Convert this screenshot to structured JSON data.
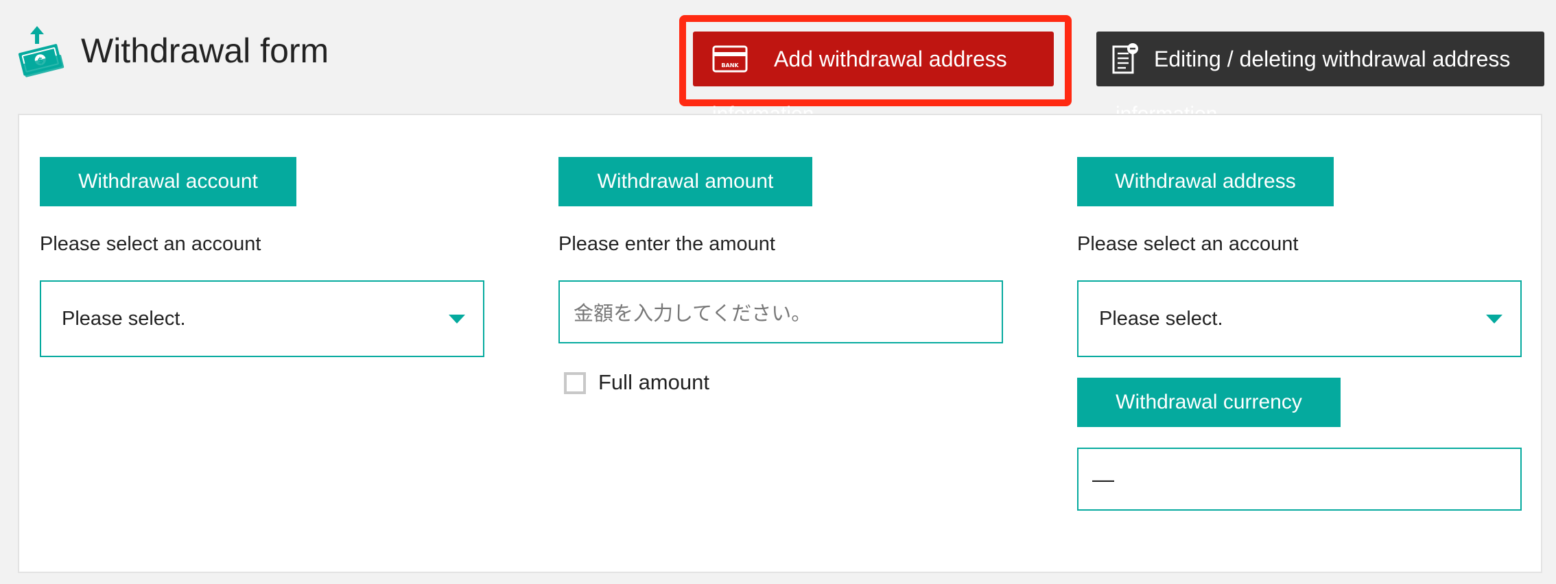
{
  "header": {
    "title": "Withdrawal form",
    "page_icon": "money-withdraw-icon"
  },
  "actions": {
    "add_address": {
      "label": "Add withdrawal address",
      "caption": "information",
      "icon": "bank-card-icon",
      "color": "#bf1511"
    },
    "edit_address": {
      "label": "Editing / deleting withdrawal address",
      "caption": "information",
      "icon": "document-remove-icon",
      "color": "#333333"
    },
    "highlight_color": "#ff2a12"
  },
  "form": {
    "accent_color": "#05aa9e",
    "account": {
      "heading": "Withdrawal account",
      "instruction": "Please select an account",
      "selected": "Please select."
    },
    "amount": {
      "heading": "Withdrawal amount",
      "instruction": "Please enter the amount",
      "placeholder": "金額を入力してください。",
      "full_amount_label": "Full amount",
      "full_amount_checked": false
    },
    "address": {
      "heading": "Withdrawal address",
      "instruction": "Please select an account",
      "selected": "Please select."
    },
    "currency": {
      "heading": "Withdrawal currency",
      "value": "—"
    }
  }
}
